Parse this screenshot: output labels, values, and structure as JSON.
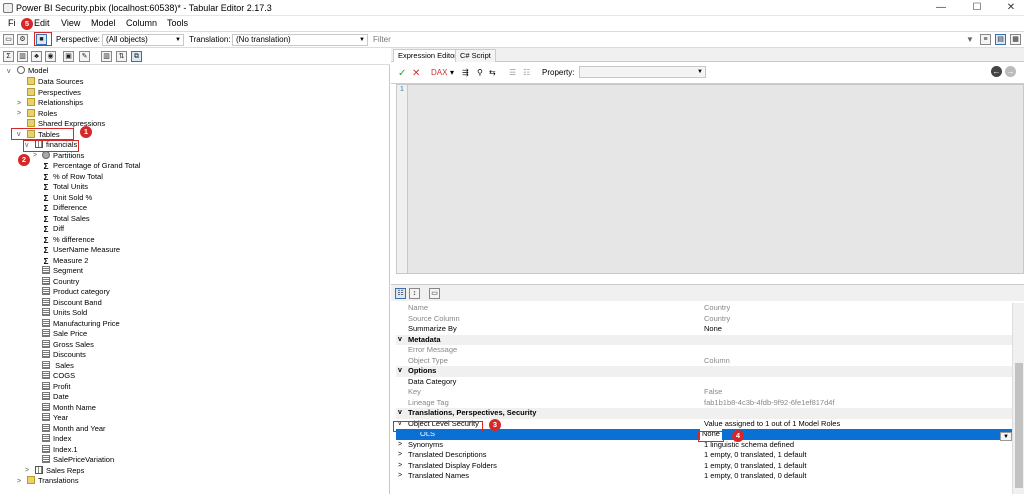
{
  "window": {
    "title": "Power BI Security.pbix (localhost:60538)* - Tabular Editor 2.17.3",
    "minimize": "—",
    "maximize": "☐",
    "close": "✕"
  },
  "menu": [
    "Fi",
    "Edit",
    "View",
    "Model",
    "Column",
    "Tools"
  ],
  "toolbar": {
    "perspective_label": "Perspective:",
    "perspective_value": "(All objects)",
    "translation_label": "Translation:",
    "translation_value": "(No translation)",
    "filter_placeholder": "Filter"
  },
  "tree": {
    "root": "Model",
    "groups": [
      "Data Sources",
      "Perspectives",
      "Relationships",
      "Roles",
      "Shared Expressions",
      "Tables"
    ],
    "table": "financials",
    "partitions": "Partitions",
    "measures": [
      "Percentage of Grand Total",
      "% of Row Total",
      "Total Units",
      "Unit Sold %",
      "Difference",
      "Total Sales",
      "Diff",
      "% difference",
      "UserName Measure",
      "Measure 2"
    ],
    "columns": [
      "Segment",
      "Country",
      "Product category",
      "Discount Band",
      "Units Sold",
      "Manufacturing Price",
      "Sale Price",
      "Gross Sales",
      "Discounts",
      " Sales",
      "COGS",
      "Profit",
      "Date",
      "Month Name",
      "Year",
      "Month and Year",
      "Index",
      "Index.1",
      "SalePriceVariation"
    ],
    "other_table": "Sales Reps",
    "translations": "Translations"
  },
  "badges": [
    "1",
    "2",
    "3",
    "4",
    "5"
  ],
  "editor": {
    "tabs": [
      "Expression Editor",
      "C# Script"
    ],
    "property_label": "Property:",
    "line_number": "1"
  },
  "properties": [
    {
      "name": "Name",
      "value": "Country",
      "kind": "grey"
    },
    {
      "name": "Source Column",
      "value": "Country",
      "kind": "grey"
    },
    {
      "name": "Summarize By",
      "value": "None",
      "kind": "normal"
    },
    {
      "name": "Metadata",
      "value": "",
      "kind": "cat"
    },
    {
      "name": "Error Message",
      "value": "",
      "kind": "grey"
    },
    {
      "name": "Object Type",
      "value": "Column",
      "kind": "grey"
    },
    {
      "name": "Options",
      "value": "",
      "kind": "cat"
    },
    {
      "name": "Data Category",
      "value": "",
      "kind": "normal"
    },
    {
      "name": "Key",
      "value": "False",
      "kind": "grey"
    },
    {
      "name": "Lineage Tag",
      "value": "fab1b1b8-4c3b-4fdb-9f92-6fe1ef817d4f",
      "kind": "grey"
    },
    {
      "name": "Translations, Perspectives, Security",
      "value": "",
      "kind": "cat"
    },
    {
      "name": "Object Level Security",
      "value": "Value assigned to 1 out of 1 Model Roles",
      "kind": "normal"
    },
    {
      "name": "OLS",
      "value": "None",
      "kind": "sel"
    },
    {
      "name": "Synonyms",
      "value": "1 linguistic schema defined",
      "kind": "normal"
    },
    {
      "name": "Translated Descriptions",
      "value": "1 empty, 0 translated, 1 default",
      "kind": "normal"
    },
    {
      "name": "Translated Display Folders",
      "value": "1 empty, 0 translated, 1 default",
      "kind": "normal"
    },
    {
      "name": "Translated Names",
      "value": "1 empty, 0 translated, 0 default",
      "kind": "normal"
    }
  ],
  "colors": {
    "accent": "#0a70d4",
    "annotation_red": "#d62828",
    "folder": "#e8d26d"
  }
}
